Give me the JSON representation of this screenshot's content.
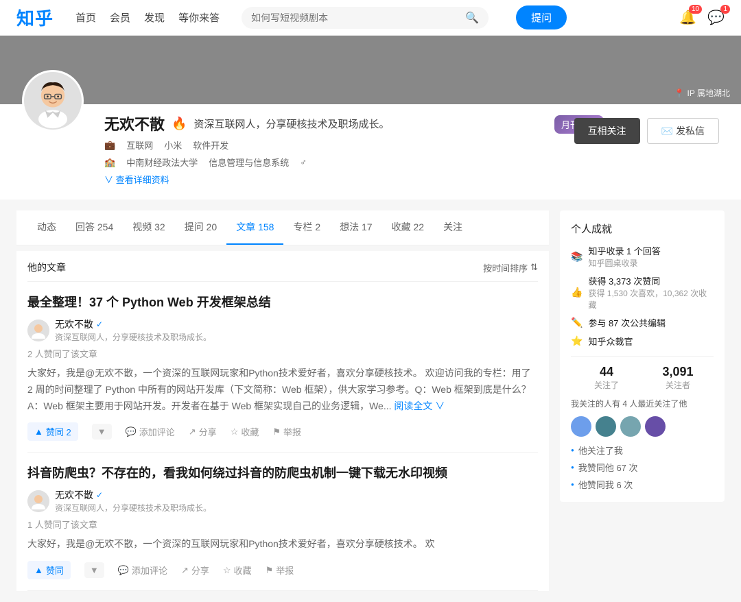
{
  "header": {
    "logo": "知乎",
    "nav": [
      "首页",
      "会员",
      "发现",
      "等你来答"
    ],
    "search_placeholder": "如何写短视频剧本",
    "ask_button": "提问",
    "notification_count": "10",
    "message_count": "1"
  },
  "profile": {
    "name": "无欢不散",
    "bio": "资深互联网人，分享硬核技术及职场成长。",
    "tags": [
      "互联网",
      "小米",
      "软件开发"
    ],
    "education": "中南财经政法大学",
    "major": "信息管理与信息系统",
    "gender": "♂",
    "view_detail": "查看详细资料",
    "ip_location": "IP 属地湖北",
    "follow_btn": "互相关注",
    "message_btn": "发私信",
    "achievement_badge": "月刊先然"
  },
  "tabs": [
    {
      "label": "动态",
      "count": ""
    },
    {
      "label": "回答",
      "count": "254"
    },
    {
      "label": "视频",
      "count": "32"
    },
    {
      "label": "提问",
      "count": "20"
    },
    {
      "label": "文章",
      "count": "158",
      "active": true
    },
    {
      "label": "专栏",
      "count": "2"
    },
    {
      "label": "想法",
      "count": "17"
    },
    {
      "label": "收藏",
      "count": "22"
    },
    {
      "label": "关注",
      "count": ""
    }
  ],
  "articles_section": {
    "title": "他的文章",
    "sort_label": "按时间排序",
    "articles": [
      {
        "title": "最全整理！37 个 Python Web 开发框架总结",
        "author": "无欢不散",
        "verified": true,
        "author_bio": "资深互联网人，分享硬核技术及职场成长。",
        "like_text": "2 人赞同了该文章",
        "excerpt": "大家好，我是@无欢不散，一个资深的互联网玩家和Python技术爱好者，喜欢分享硬核技术。 欢迎访问我的专栏：用了 2 周的时间整理了 Python 中所有的网站开发库（下文简称：Web 框架），供大家学习参考。Q：Web 框架到底是什么？A：Web 框架主要用于网站开发。开发者在基于 Web 框架实现自己的业务逻辑，We...",
        "read_more": "阅读全文 ∨",
        "vote_label": "赞同 2",
        "actions": [
          "添加评论",
          "分享",
          "收藏",
          "举报"
        ]
      },
      {
        "title": "抖音防爬虫？不存在的，看我如何绕过抖音的防爬虫机制一键下载无水印视频",
        "author": "无欢不散",
        "verified": true,
        "author_bio": "资深互联网人，分享硬核技术及职场成长。",
        "like_text": "1 人赞同了该文章",
        "excerpt": "大家好，我是@无欢不散，一个资深的互联网玩家和Python技术爱好者，喜欢分享硬核技术。 欢",
        "read_more": "",
        "vote_label": "赞同",
        "actions": [
          "添加评论",
          "分享",
          "收藏",
          "举报"
        ]
      }
    ]
  },
  "sidebar": {
    "achievements_title": "个人成就",
    "achievements": [
      {
        "icon": "📚",
        "text": "知乎收录 1 个回答",
        "sub": "知乎圆桌收录"
      },
      {
        "icon": "👍",
        "text": "获得 3,373 次赞同",
        "sub": "获得 1,530 次喜欢，10,362 次收藏"
      },
      {
        "icon": "✏️",
        "text": "参与 87 次公共编辑"
      },
      {
        "icon": "⭐",
        "text": "知乎众裁官"
      }
    ],
    "following_count": "44",
    "followers_count": "3,091",
    "following_label": "关注了",
    "followers_label": "关注者",
    "recent_followers_note": "我关注的人有 4 人最近关注了他",
    "follower_avatars": [
      "#6d9eeb",
      "#45818e",
      "#76a5af",
      "#674ea7"
    ],
    "social_info": [
      {
        "icon": "💙",
        "text": "他关注了我"
      },
      {
        "icon": "👤",
        "text": "我赞同他 67 次"
      },
      {
        "icon": "👥",
        "text": "他赞同我 6 次"
      }
    ]
  }
}
